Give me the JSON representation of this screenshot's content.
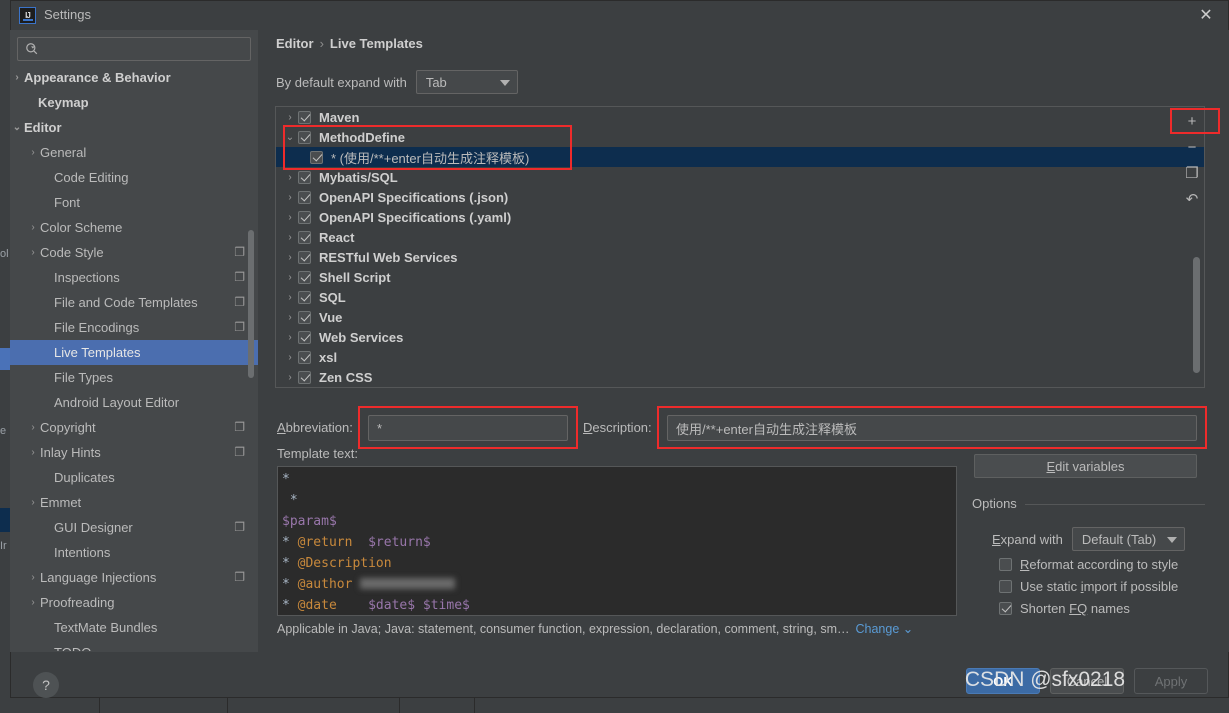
{
  "window": {
    "title": "Settings",
    "logo_icon": "intellij-idea-logo",
    "close_icon": "close-icon"
  },
  "sidebar": {
    "search": {
      "placeholder": "",
      "value": "",
      "icon": "search-icon"
    },
    "items": [
      {
        "label": "Appearance & Behavior",
        "arrow": "›",
        "indent": 8,
        "bold": true,
        "copy": false,
        "selected": false
      },
      {
        "label": "Keymap",
        "arrow": "",
        "indent": 22,
        "bold": true,
        "copy": false,
        "selected": false
      },
      {
        "label": "Editor",
        "arrow": "⌄",
        "indent": 8,
        "bold": true,
        "copy": false,
        "selected": false
      },
      {
        "label": "General",
        "arrow": "›",
        "indent": 24,
        "bold": false,
        "copy": false,
        "selected": false
      },
      {
        "label": "Code Editing",
        "arrow": "",
        "indent": 38,
        "bold": false,
        "copy": false,
        "selected": false
      },
      {
        "label": "Font",
        "arrow": "",
        "indent": 38,
        "bold": false,
        "copy": false,
        "selected": false
      },
      {
        "label": "Color Scheme",
        "arrow": "›",
        "indent": 24,
        "bold": false,
        "copy": false,
        "selected": false
      },
      {
        "label": "Code Style",
        "arrow": "›",
        "indent": 24,
        "bold": false,
        "copy": true,
        "selected": false
      },
      {
        "label": "Inspections",
        "arrow": "",
        "indent": 38,
        "bold": false,
        "copy": true,
        "selected": false
      },
      {
        "label": "File and Code Templates",
        "arrow": "",
        "indent": 38,
        "bold": false,
        "copy": true,
        "selected": false
      },
      {
        "label": "File Encodings",
        "arrow": "",
        "indent": 38,
        "bold": false,
        "copy": true,
        "selected": false
      },
      {
        "label": "Live Templates",
        "arrow": "",
        "indent": 38,
        "bold": false,
        "copy": false,
        "selected": true
      },
      {
        "label": "File Types",
        "arrow": "",
        "indent": 38,
        "bold": false,
        "copy": false,
        "selected": false
      },
      {
        "label": "Android Layout Editor",
        "arrow": "",
        "indent": 38,
        "bold": false,
        "copy": false,
        "selected": false
      },
      {
        "label": "Copyright",
        "arrow": "›",
        "indent": 24,
        "bold": false,
        "copy": true,
        "selected": false
      },
      {
        "label": "Inlay Hints",
        "arrow": "›",
        "indent": 24,
        "bold": false,
        "copy": true,
        "selected": false
      },
      {
        "label": "Duplicates",
        "arrow": "",
        "indent": 38,
        "bold": false,
        "copy": false,
        "selected": false
      },
      {
        "label": "Emmet",
        "arrow": "›",
        "indent": 24,
        "bold": false,
        "copy": false,
        "selected": false
      },
      {
        "label": "GUI Designer",
        "arrow": "",
        "indent": 38,
        "bold": false,
        "copy": true,
        "selected": false
      },
      {
        "label": "Intentions",
        "arrow": "",
        "indent": 38,
        "bold": false,
        "copy": false,
        "selected": false
      },
      {
        "label": "Language Injections",
        "arrow": "›",
        "indent": 24,
        "bold": false,
        "copy": true,
        "selected": false
      },
      {
        "label": "Proofreading",
        "arrow": "›",
        "indent": 24,
        "bold": false,
        "copy": false,
        "selected": false
      },
      {
        "label": "TextMate Bundles",
        "arrow": "",
        "indent": 38,
        "bold": false,
        "copy": false,
        "selected": false
      },
      {
        "label": "TODO",
        "arrow": "",
        "indent": 38,
        "bold": false,
        "copy": false,
        "selected": false
      }
    ]
  },
  "main": {
    "breadcrumb": {
      "parent": "Editor",
      "separator": "›",
      "current": "Live Templates"
    },
    "expand_with": {
      "label": "By default expand with",
      "value": "Tab"
    },
    "templates": [
      {
        "label": "Maven",
        "checked": true,
        "child": false,
        "arrow": "›",
        "selected": false
      },
      {
        "label": "MethodDefine",
        "checked": true,
        "child": false,
        "arrow": "⌄",
        "selected": false
      },
      {
        "label": "* (使用/**+enter自动生成注释模板)",
        "checked": true,
        "child": true,
        "arrow": "",
        "selected": true
      },
      {
        "label": "Mybatis/SQL",
        "checked": true,
        "child": false,
        "arrow": "›",
        "selected": false
      },
      {
        "label": "OpenAPI Specifications (.json)",
        "checked": true,
        "child": false,
        "arrow": "›",
        "selected": false
      },
      {
        "label": "OpenAPI Specifications (.yaml)",
        "checked": true,
        "child": false,
        "arrow": "›",
        "selected": false
      },
      {
        "label": "React",
        "checked": true,
        "child": false,
        "arrow": "›",
        "selected": false
      },
      {
        "label": "RESTful Web Services",
        "checked": true,
        "child": false,
        "arrow": "›",
        "selected": false
      },
      {
        "label": "Shell Script",
        "checked": true,
        "child": false,
        "arrow": "›",
        "selected": false
      },
      {
        "label": "SQL",
        "checked": true,
        "child": false,
        "arrow": "›",
        "selected": false
      },
      {
        "label": "Vue",
        "checked": true,
        "child": false,
        "arrow": "›",
        "selected": false
      },
      {
        "label": "Web Services",
        "checked": true,
        "child": false,
        "arrow": "›",
        "selected": false
      },
      {
        "label": "xsl",
        "checked": true,
        "child": false,
        "arrow": "›",
        "selected": false
      },
      {
        "label": "Zen CSS",
        "checked": true,
        "child": false,
        "arrow": "›",
        "selected": false
      }
    ],
    "toolbar": [
      {
        "icon": "add-icon",
        "glyph": "+",
        "name": "add-template-button"
      },
      {
        "icon": "remove-icon",
        "glyph": "−",
        "name": "remove-template-button"
      },
      {
        "icon": "copy-icon",
        "glyph": "❐",
        "name": "duplicate-template-button"
      },
      {
        "icon": "revert-icon",
        "glyph": "↶",
        "name": "restore-defaults-button"
      }
    ],
    "abbreviation": {
      "label": "Abbreviation:",
      "accel": "b",
      "value": "*"
    },
    "description": {
      "label": "Description:",
      "accel": "D",
      "value": "使用/**+enter自动生成注释模板"
    },
    "template_text_label": "Template text:",
    "template_text_lines": [
      "*",
      " *",
      "$param$",
      "* @return  $return$",
      "* @Description",
      "* @author ",
      "* @date    $date$ $time$"
    ],
    "applicable": "Applicable in Java; Java: statement, consumer function, expression, declaration, comment, string, sm…",
    "change_link": "Change"
  },
  "options": {
    "edit_variables_label": "Edit variables",
    "title": "Options",
    "expand_with": {
      "label": "Expand with",
      "value": "Default (Tab)"
    },
    "checkboxes": [
      {
        "label": "Reformat according to style",
        "checked": false
      },
      {
        "label": "Use static import if possible",
        "checked": false
      },
      {
        "label": "Shorten FQ names",
        "checked": true
      }
    ]
  },
  "footer": {
    "help_label": "?",
    "ok_label": "OK",
    "cancel_label": "Cancel",
    "apply_label": "Apply"
  },
  "watermark": "CSDN @sfx0218",
  "colors": {
    "accent_blue": "#4b6eaf",
    "highlight_red": "#ee2b2b",
    "selection_navy": "#0d2d4e",
    "link_blue": "#5a9bd5"
  }
}
